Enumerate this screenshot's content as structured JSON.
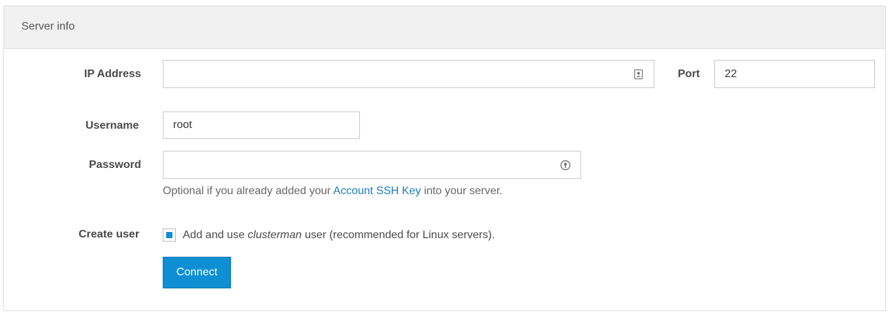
{
  "panel": {
    "title": "Server info"
  },
  "form": {
    "ip_label": "IP Address",
    "ip_value": "",
    "port_label": "Port",
    "port_value": "22",
    "username_label": "Username",
    "username_value": "root",
    "password_label": "Password",
    "password_value": "",
    "help_prefix": "Optional if you already added your ",
    "help_link": "Account SSH Key",
    "help_suffix": " into your server.",
    "create_user_label": "Create user",
    "checkbox_prefix": "Add and use ",
    "checkbox_em": "clusterman",
    "checkbox_suffix": " user (recommended for Linux servers).",
    "checkbox_checked": true,
    "connect_label": "Connect"
  },
  "icons": {
    "ip_field_icon": "contact-card-icon",
    "password_field_icon": "password-manager-icon"
  },
  "colors": {
    "accent": "#0e8ed3",
    "link": "#1b7bc0",
    "header_bg": "#f1f1f1"
  }
}
